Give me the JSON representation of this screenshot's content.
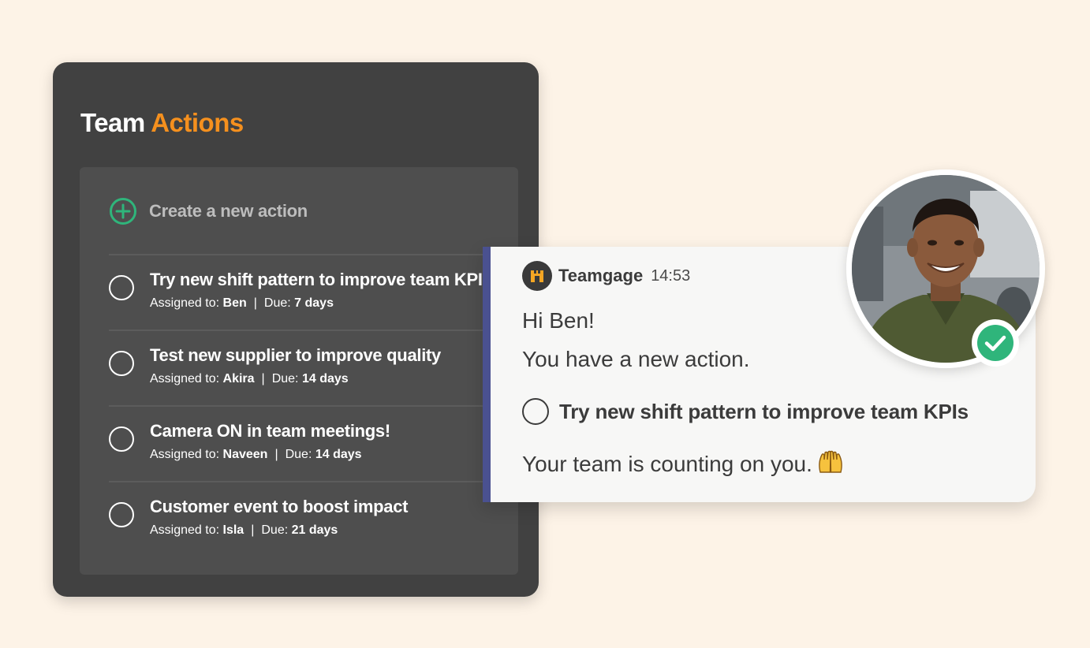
{
  "colors": {
    "background": "#fdf3e7",
    "panel": "#414141",
    "card": "#4e4e4e",
    "accent": "#f5901e",
    "create_green": "#2fb57b",
    "notif_bar": "#4a5190",
    "check_green": "#2fb57b"
  },
  "panel": {
    "title_part1": "Team",
    "title_part2": "Actions",
    "create_label": "Create a new action",
    "create_icon": "plus-circle-icon"
  },
  "actions": [
    {
      "title": "Try new shift pattern to improve team KPIs",
      "assigned_label": "Assigned to:",
      "assignee": "Ben",
      "due_label": "Due:",
      "due": "7 days"
    },
    {
      "title": "Test new supplier to improve quality",
      "assigned_label": "Assigned to:",
      "assignee": "Akira",
      "due_label": "Due:",
      "due": "14 days"
    },
    {
      "title": "Camera ON in team meetings!",
      "assigned_label": "Assigned to:",
      "assignee": "Naveen",
      "due_label": "Due:",
      "due": "14 days"
    },
    {
      "title": "Customer event to boost impact",
      "assigned_label": "Assigned to:",
      "assignee": "Isla",
      "due_label": "Due:",
      "due": "21 days"
    }
  ],
  "separator": "|",
  "notification": {
    "app_name": "Teamgage",
    "time": "14:53",
    "greeting": "Hi Ben!",
    "message": "You have a new action.",
    "task": "Try new shift pattern to improve team KPIs",
    "footer": "Your team is counting on you.",
    "footer_icon": "raised-hands-icon",
    "app_icon": "teamgage-logo-icon"
  },
  "avatar": {
    "icon": "user-avatar-photo",
    "status_icon": "check-circle-icon"
  }
}
